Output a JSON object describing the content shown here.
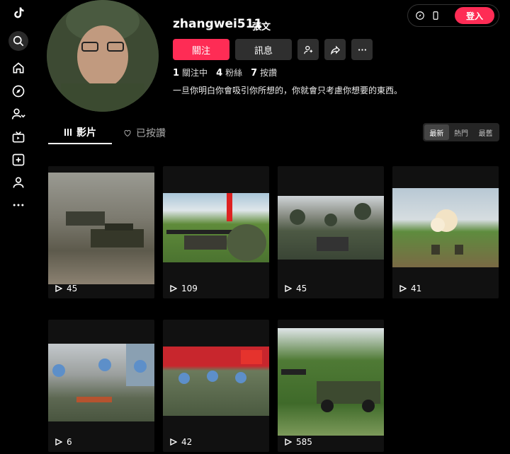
{
  "profile": {
    "username": "zhangwei511",
    "nickname": "張文",
    "follow_label": "關注",
    "message_label": "訊息",
    "following_count": "1",
    "following_label": "關注中",
    "followers_count": "4",
    "followers_label": "粉絲",
    "likes_count": "7",
    "likes_label": "按讚",
    "bio": "一旦你明白你會吸引你所想的，你就會只考慮你想要的東西。"
  },
  "top": {
    "login_label": "登入"
  },
  "tabs": {
    "videos": "影片",
    "liked": "已按讚"
  },
  "sort": {
    "latest": "最新",
    "popular": "熱門",
    "oldest": "最舊"
  },
  "videos": [
    {
      "views": "45"
    },
    {
      "views": "109"
    },
    {
      "views": "45"
    },
    {
      "views": "41"
    },
    {
      "views": "6"
    },
    {
      "views": "42"
    },
    {
      "views": "585"
    }
  ],
  "colors": {
    "accent": "#fe2c55",
    "background": "#000000"
  }
}
